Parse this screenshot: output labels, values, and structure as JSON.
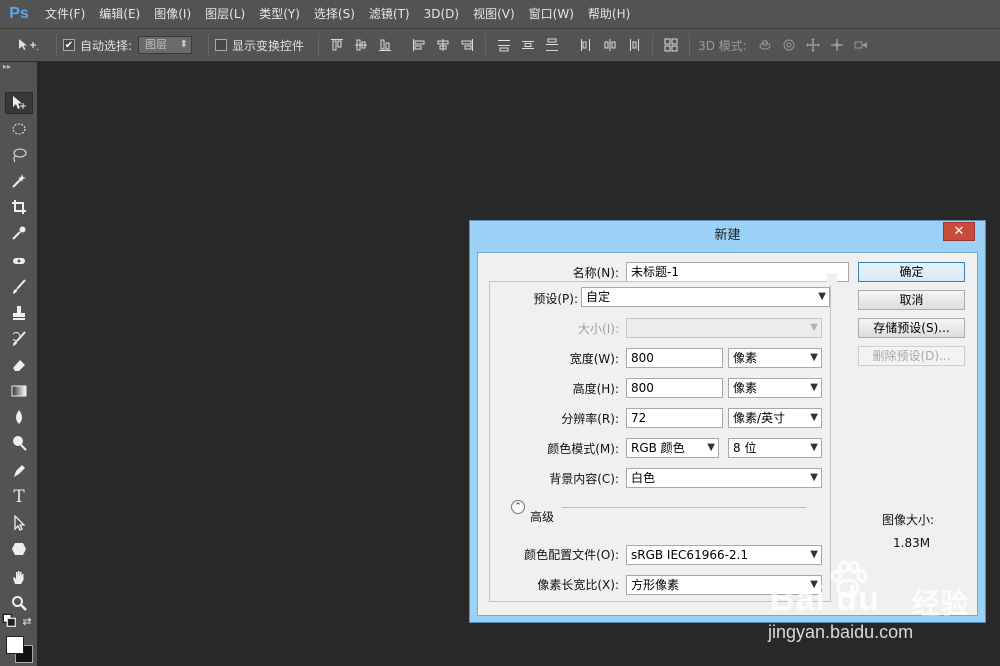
{
  "app": {
    "logo": "Ps"
  },
  "menu": [
    "文件(F)",
    "编辑(E)",
    "图像(I)",
    "图层(L)",
    "类型(Y)",
    "选择(S)",
    "滤镜(T)",
    "3D(D)",
    "视图(V)",
    "窗口(W)",
    "帮助(H)"
  ],
  "options": {
    "auto_select_label": "自动选择:",
    "auto_select_checked": true,
    "auto_select_value": "图层",
    "show_transform_label": "显示变换控件",
    "show_transform_checked": false,
    "mode3d_label": "3D 模式:"
  },
  "toolbar": {
    "tools": [
      "move-tool",
      "marquee-tool",
      "lasso-tool",
      "magic-wand-tool",
      "crop-tool",
      "eyedropper-tool",
      "spot-healing-tool",
      "brush-tool",
      "clone-stamp-tool",
      "history-brush-tool",
      "eraser-tool",
      "gradient-tool",
      "blur-tool",
      "dodge-tool",
      "pen-tool",
      "type-tool",
      "path-selection-tool",
      "shape-tool",
      "hand-tool",
      "zoom-tool"
    ],
    "foreground_color": "#ffffff",
    "background_color": "#111111"
  },
  "dialog": {
    "title": "新建",
    "close": "✕",
    "name_label": "名称(N):",
    "name_value": "未标题-1",
    "preset_label": "预设(P):",
    "preset_value": "自定",
    "size_label": "大小(I):",
    "size_value": "",
    "width_label": "宽度(W):",
    "width_value": "800",
    "width_unit": "像素",
    "height_label": "高度(H):",
    "height_value": "800",
    "height_unit": "像素",
    "resolution_label": "分辨率(R):",
    "resolution_value": "72",
    "resolution_unit": "像素/英寸",
    "color_mode_label": "颜色模式(M):",
    "color_mode_value": "RGB 颜色",
    "bit_depth_value": "8 位",
    "background_label": "背景内容(C):",
    "background_value": "白色",
    "advanced_label": "高级",
    "color_profile_label": "颜色配置文件(O):",
    "color_profile_value": "sRGB IEC61966-2.1",
    "pixel_aspect_label": "像素长宽比(X):",
    "pixel_aspect_value": "方形像素",
    "buttons": {
      "ok": "确定",
      "cancel": "取消",
      "save_preset": "存储预设(S)...",
      "delete_preset": "删除预设(D)..."
    },
    "image_size_label": "图像大小:",
    "image_size_value": "1.83M"
  },
  "watermark": {
    "logo": "Bai du",
    "cn": "经验",
    "url": "jingyan.baidu.com"
  }
}
